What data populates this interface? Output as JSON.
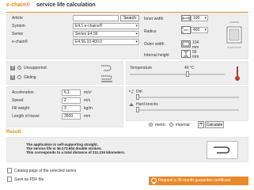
{
  "header": {
    "brand": "e-chain®",
    "title": "service life calculation"
  },
  "left_form": {
    "article_label": "Article",
    "article_value": "",
    "search_label": "Search",
    "system_label": "System",
    "system_value": "E4.1 e-chains®",
    "series_label": "Series",
    "series_value": "Series E4.56",
    "echain_label": "e-chain®",
    "echain_value": "E4.56.10.400.0"
  },
  "right_form": {
    "inner_width_label": "Inner width",
    "inner_width_value": "100",
    "radius_label": "Radius",
    "radius_value": "400",
    "outer_width_label": "Outer width",
    "outer_width_value": "134",
    "outer_width_unit": "mm",
    "internal_height_label": "Internal height",
    "internal_height_value": "56",
    "internal_height_unit": "mm"
  },
  "support": {
    "help1": "?",
    "unsupported_label": "Unsupported",
    "help2": "?",
    "gliding_label": "Gliding"
  },
  "temperature": {
    "label": "Temperature",
    "value": "40 °C"
  },
  "motion": {
    "acceleration_label": "Acceleration",
    "acceleration_value": "6.1",
    "acceleration_unit": "m/s²",
    "speed_label": "Speed",
    "speed_value": "2",
    "speed_unit": "m/s",
    "fill_weight_label": "Fill weight",
    "fill_weight_value": "3",
    "fill_weight_unit": "kg/m",
    "travel_label": "Length of travel",
    "travel_value": "3500",
    "travel_unit": "mm"
  },
  "environment": {
    "dirt_label": "Dirt",
    "hard_knocks_label": "Hard knocks"
  },
  "units": {
    "metric_label": "metric",
    "imperial_label": "imperial",
    "calculate_label": "Calculate"
  },
  "result": {
    "title": "Result",
    "line1": "The application is self-supporting straight.",
    "line2": "The service life is 36.173.604 double strokes.",
    "line3": "This corresponds to a total distance of 211.216 kilometers."
  },
  "footer": {
    "catalog_label": "Catalog page of the selected series",
    "pdf_label": "Save as PDF file",
    "request_label": "Request a 36 month guarantee certificate"
  },
  "colors": {
    "accent": "#e08a1e",
    "cta": "#e8892a",
    "panel": "#eeeeee",
    "thermometer": "#c0392b"
  }
}
